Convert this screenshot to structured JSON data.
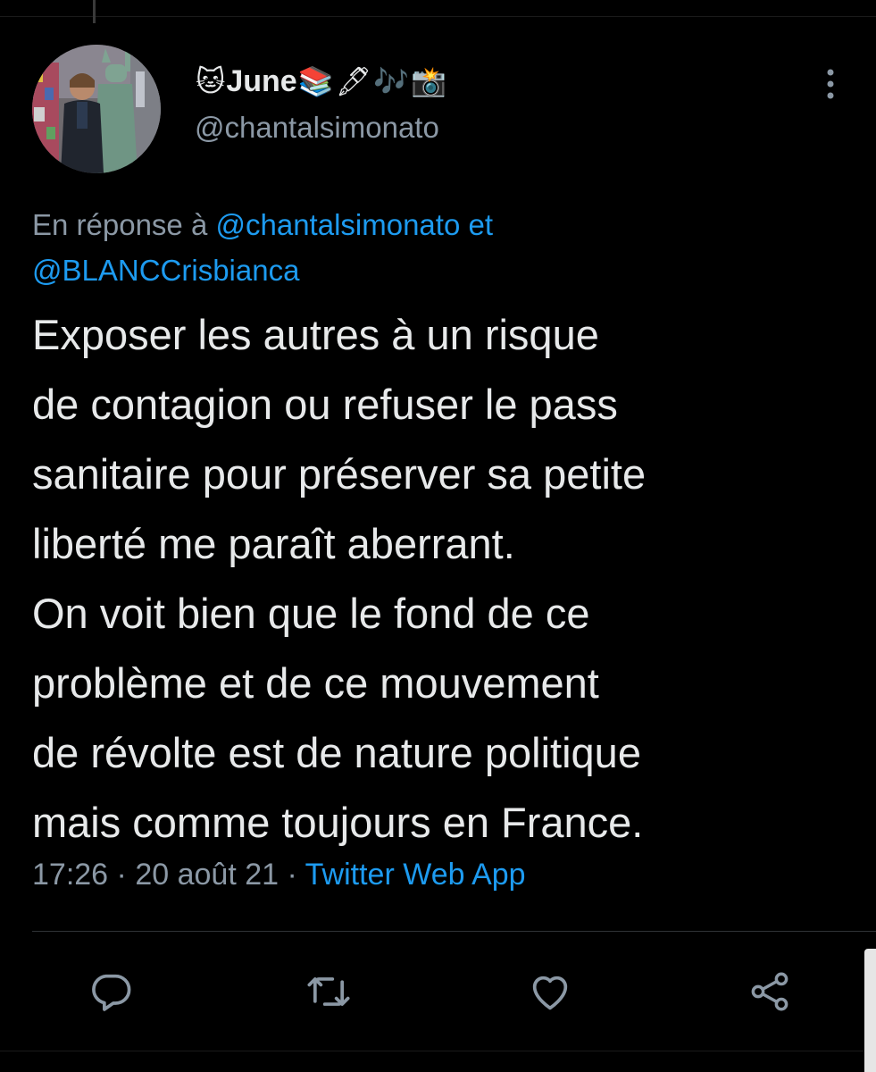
{
  "author": {
    "name": "June",
    "name_emojis": [
      "🐱",
      "📚",
      "🖋",
      "🎶",
      "📸"
    ],
    "handle": "@chantalsimonato"
  },
  "reply_context": {
    "prefix": "En réponse à",
    "mention_1": "@chantalsimonato",
    "connector": "et",
    "mention_2": "@BLANCCrisbianca"
  },
  "tweet": {
    "lines": [
      "Exposer les autres à un risque",
      "de contagion ou refuser le pass",
      "sanitaire pour préserver sa petite",
      "liberté me paraît aberrant.",
      "On voit bien que le fond de ce",
      "problème et de ce mouvement",
      "de révolte est de nature politique",
      "mais comme toujours en France."
    ]
  },
  "meta": {
    "time": "17:26",
    "separator": "·",
    "date": "20 août 21",
    "source": "Twitter Web App"
  },
  "actions": {
    "icons": [
      "reply-icon",
      "retweet-icon",
      "like-icon",
      "share-icon"
    ]
  },
  "colors": {
    "background": "#000000",
    "text": "#e7e9ea",
    "secondary": "#8b98a5",
    "accent": "#1d9bf0",
    "divider": "#2f3336"
  }
}
